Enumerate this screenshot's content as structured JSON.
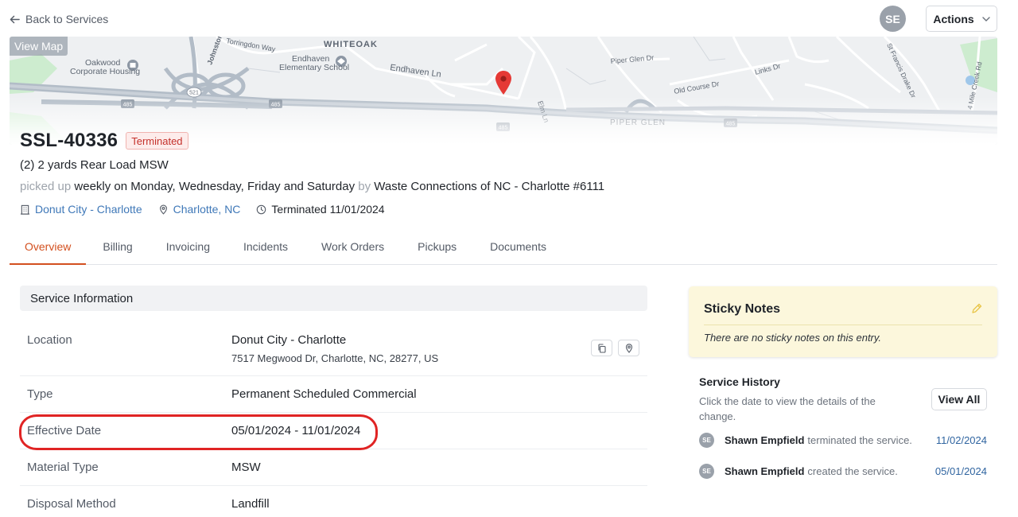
{
  "topbar": {
    "back_label": "Back to Services",
    "user_initials": "SE",
    "actions_label": "Actions"
  },
  "map": {
    "view_map_label": "View Map",
    "labels": {
      "whiteoak": "WHITEOAK",
      "endhaven_school_1": "Endhaven",
      "endhaven_school_2": "Elementary School",
      "oakwood_1": "Oakwood",
      "oakwood_2": "Corporate Housing",
      "endhaven_ln": "Endhaven Ln",
      "torringdon": "Torringdon Way",
      "johnston": "Johnston",
      "piper_glen_dr": "Piper Glen Dr",
      "piper_glen": "PIPER GLEN",
      "links_dr": "Links Dr",
      "old_course": "Old Course Dr",
      "elm_ln": "Elm Ln",
      "st_francis": "St Francis Drake Dr",
      "mile_creek": "4 Mile Creek Rd",
      "shield_485": "485",
      "shield_521": "521"
    },
    "colors": {
      "pin": "#e53935",
      "park": "#cdeccf",
      "road": "#c3cad3",
      "highway": "#b2bcc7"
    }
  },
  "service": {
    "id": "SSL-40336",
    "status": "Terminated",
    "description": "(2) 2 yards Rear Load MSW",
    "sched_prefix": "picked up",
    "sched_freq": "weekly on Monday, Wednesday, Friday and Saturday",
    "sched_by": "by",
    "vendor": "Waste Connections of NC - Charlotte #6111",
    "meta": {
      "location": "Donut City - Charlotte",
      "city": "Charlotte, NC",
      "terminated": "Terminated 11/01/2024"
    }
  },
  "tabs": [
    {
      "label": "Overview",
      "active": true
    },
    {
      "label": "Billing"
    },
    {
      "label": "Invoicing"
    },
    {
      "label": "Incidents"
    },
    {
      "label": "Work Orders"
    },
    {
      "label": "Pickups"
    },
    {
      "label": "Documents"
    }
  ],
  "service_info": {
    "title": "Service Information",
    "location_label": "Location",
    "location_name": "Donut City - Charlotte",
    "location_address": "7517 Megwood Dr, Charlotte, NC, 28277, US",
    "type_label": "Type",
    "type_value": "Permanent Scheduled Commercial",
    "effective_label": "Effective Date",
    "effective_value": "05/01/2024 - 11/01/2024",
    "material_label": "Material Type",
    "material_value": "MSW",
    "disposal_label": "Disposal Method",
    "disposal_value": "Landfill"
  },
  "sticky_notes": {
    "title": "Sticky Notes",
    "empty": "There are no sticky notes on this entry."
  },
  "history": {
    "title": "Service History",
    "hint": "Click the date to view the details of the change.",
    "view_all": "View All",
    "entries": [
      {
        "initials": "SE",
        "name": "Shawn Empfield",
        "action": "terminated the service.",
        "date": "11/02/2024"
      },
      {
        "initials": "SE",
        "name": "Shawn Empfield",
        "action": "created the service.",
        "date": "05/01/2024"
      }
    ]
  },
  "colors": {
    "accent": "#d3501f",
    "link": "#3f78b8",
    "terminated": "#c4312b",
    "annotation": "#e02424"
  }
}
